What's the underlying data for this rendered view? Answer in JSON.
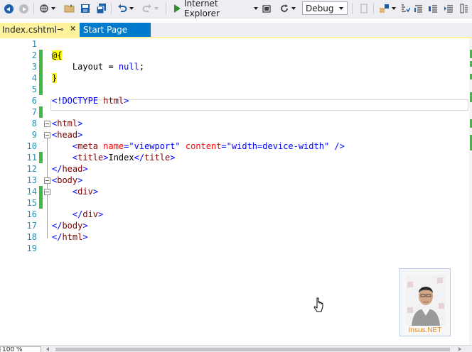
{
  "toolbar": {
    "run_target": "Internet Explorer",
    "configuration": "Debug",
    "icons": [
      "back-icon",
      "forward-icon",
      "new-project-icon",
      "open-folder-icon",
      "save-icon",
      "save-all-icon",
      "undo-icon",
      "redo-icon",
      "run-icon",
      "browser-link-icon",
      "refresh-icon",
      "attach-icon",
      "find-icon",
      "comment-icon",
      "bookmark-icon",
      "outdent-icon",
      "indent-icon"
    ]
  },
  "tabs": [
    {
      "label": "Index.cshtml",
      "active": true
    },
    {
      "label": "Start Page",
      "active": false
    }
  ],
  "editor": {
    "lines": [
      {
        "n": "1"
      },
      {
        "n": "2"
      },
      {
        "n": "3"
      },
      {
        "n": "4"
      },
      {
        "n": "5"
      },
      {
        "n": "6"
      },
      {
        "n": "7"
      },
      {
        "n": "8"
      },
      {
        "n": "9"
      },
      {
        "n": "10"
      },
      {
        "n": "11"
      },
      {
        "n": "12"
      },
      {
        "n": "13"
      },
      {
        "n": "14"
      },
      {
        "n": "15"
      },
      {
        "n": "16"
      },
      {
        "n": "17"
      },
      {
        "n": "18"
      },
      {
        "n": "19"
      }
    ],
    "code": {
      "l2": "@{",
      "l3_a": "    Layout = ",
      "l3_kw": "null",
      "l3_b": ";",
      "l4": "}",
      "l6_a": "<!DOCTYPE ",
      "l6_b": "html",
      "l6_c": ">",
      "l8_open": "<",
      "l8_tag": "html",
      "l8_close": ">",
      "l9_open": "<",
      "l9_tag": "head",
      "l9_close": ">",
      "l10_open": "    <",
      "l10_tag": "meta",
      "l10_attr1": " name",
      "l10_eq1": "=",
      "l10_val1": "\"viewport\"",
      "l10_attr2": " content",
      "l10_eq2": "=",
      "l10_val2": "\"width=device-width\"",
      "l10_end": " />",
      "l11_open": "    <",
      "l11_tag": "title",
      "l11_close": ">",
      "l11_text": "Index",
      "l11_end_open": "</",
      "l11_end_tag": "title",
      "l11_end_close": ">",
      "l12_open": "</",
      "l12_tag": "head",
      "l12_close": ">",
      "l13_open": "<",
      "l13_tag": "body",
      "l13_close": ">",
      "l14_open": "    <",
      "l14_tag": "div",
      "l14_close": ">",
      "l16_open": "    </",
      "l16_tag": "div",
      "l16_close": ">",
      "l17_open": "</",
      "l17_tag": "body",
      "l17_close": ">",
      "l18_open": "</",
      "l18_tag": "html",
      "l18_close": ">"
    }
  },
  "watermark": {
    "text": "Insus.NET"
  },
  "status": {
    "zoom": "100 %"
  },
  "colors": {
    "active_tab": "#fff29d",
    "inactive_tab": "#007acc",
    "modified_marker": "#3fb944",
    "line_number": "#2b91af",
    "tag": "#800000",
    "attribute": "#ff0000",
    "value": "#0000ff"
  }
}
